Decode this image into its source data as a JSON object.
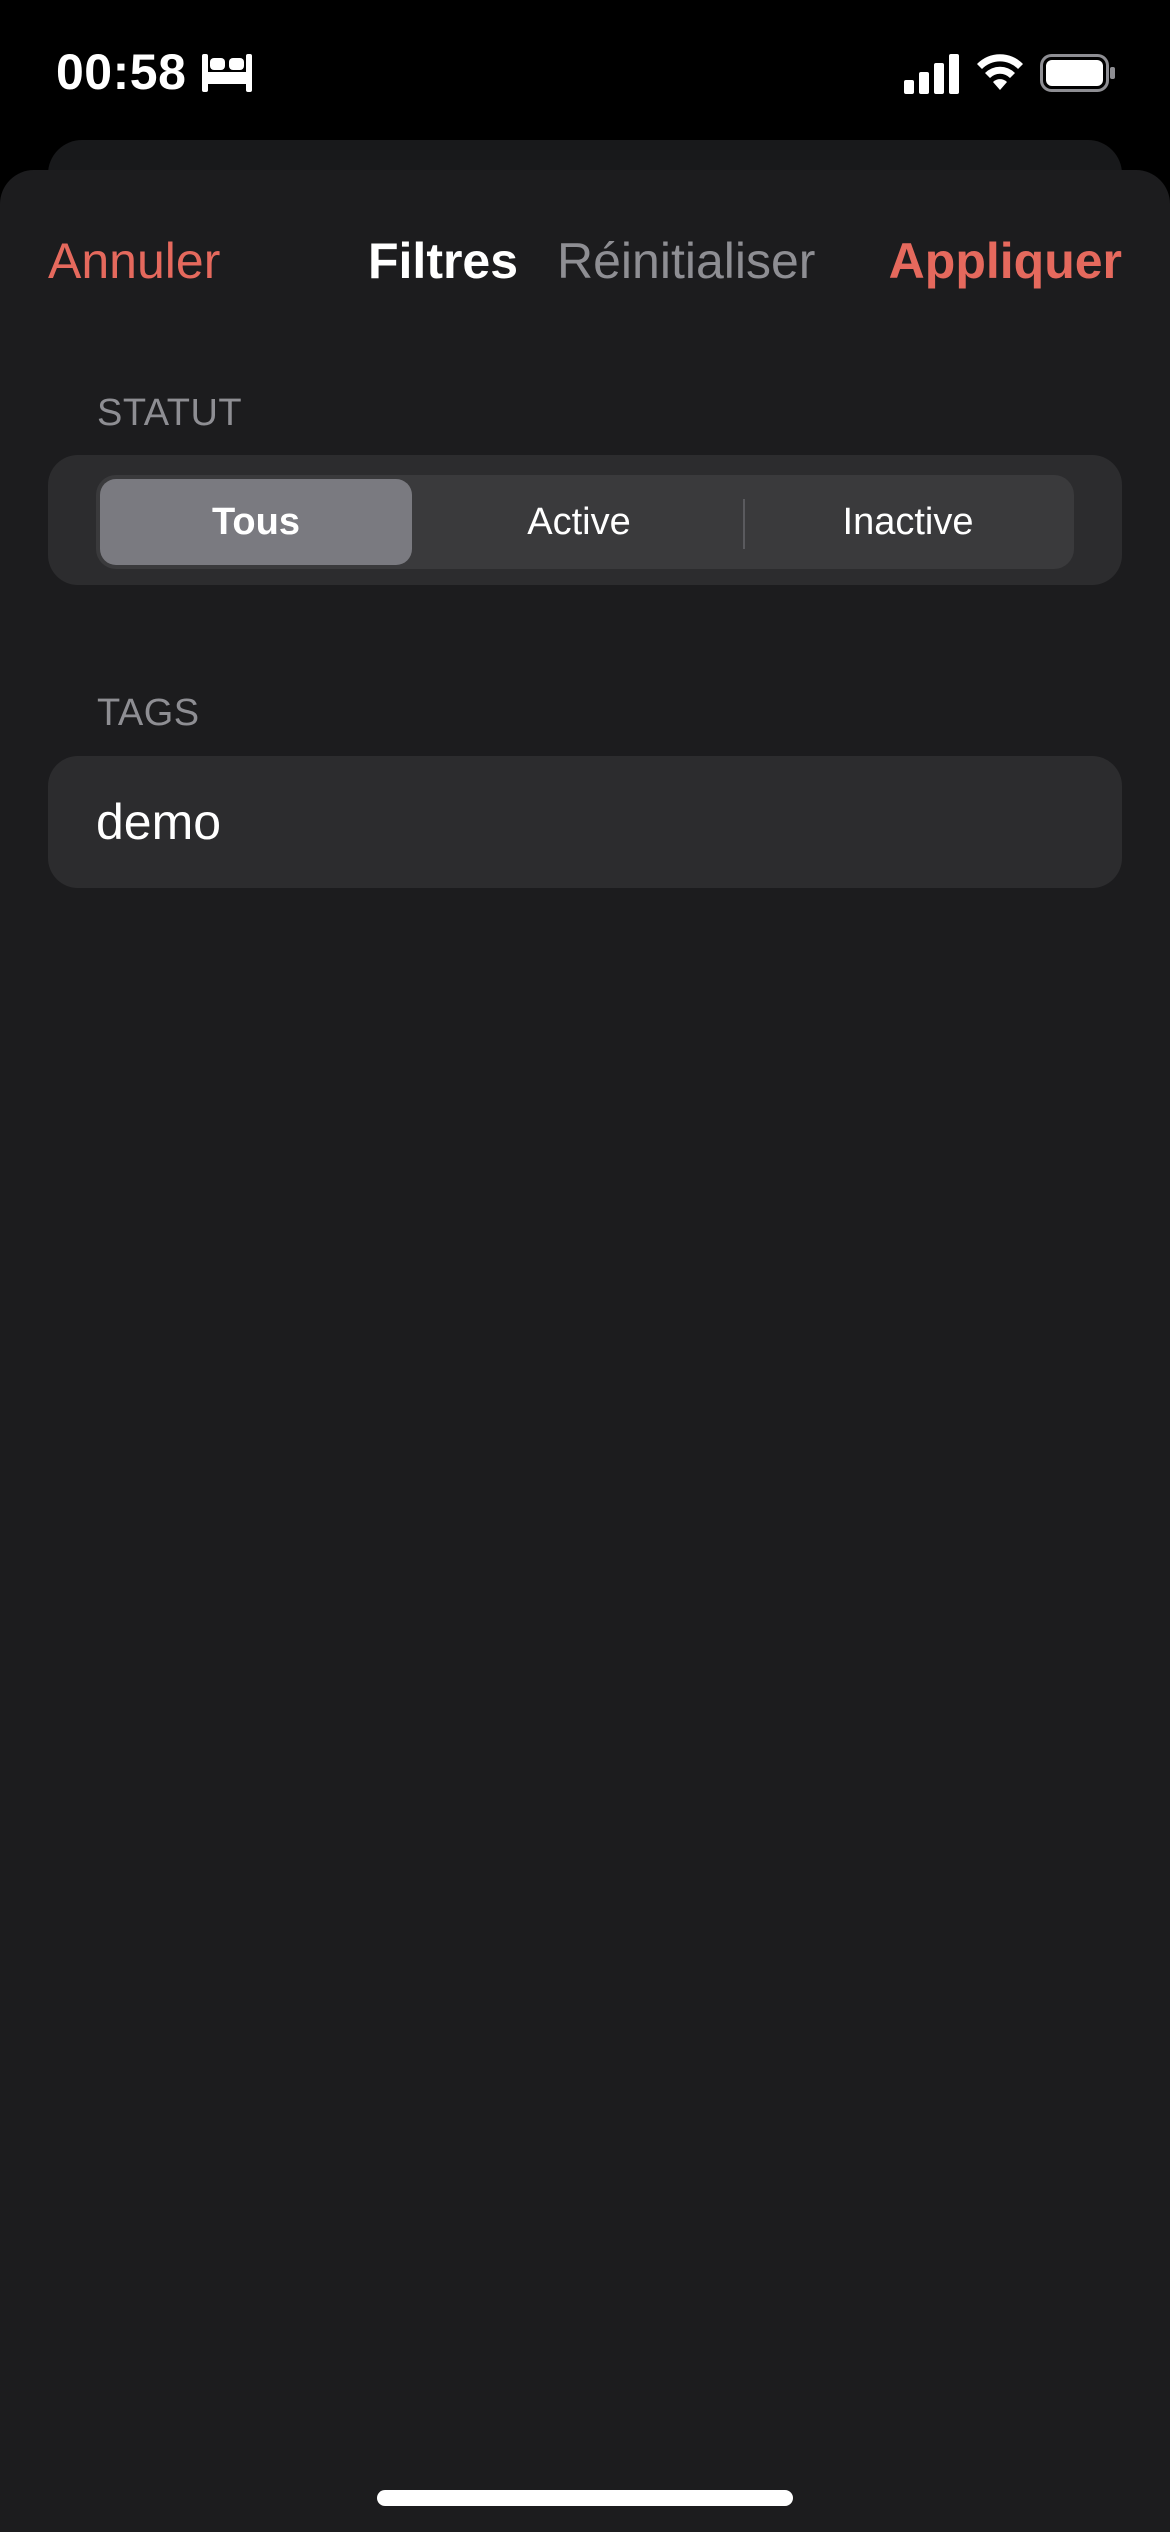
{
  "status_bar": {
    "time": "00:58",
    "focus_icon": "bed-icon",
    "signal_icon": "cellular-signal-icon",
    "wifi_icon": "wifi-icon",
    "battery_icon": "battery-icon"
  },
  "nav": {
    "cancel_label": "Annuler",
    "title": "Filtres",
    "reset_label": "Réinitialiser",
    "apply_label": "Appliquer"
  },
  "statut_section": {
    "header": "STATUT",
    "options": [
      "Tous",
      "Active",
      "Inactive"
    ],
    "selected": "Tous"
  },
  "tags_section": {
    "header": "TAGS",
    "items": [
      "demo"
    ]
  },
  "colors": {
    "accent": "#e5695d",
    "background": "#1c1c1e",
    "card": "#2c2c2e",
    "secondary_text": "#8e8e93"
  }
}
